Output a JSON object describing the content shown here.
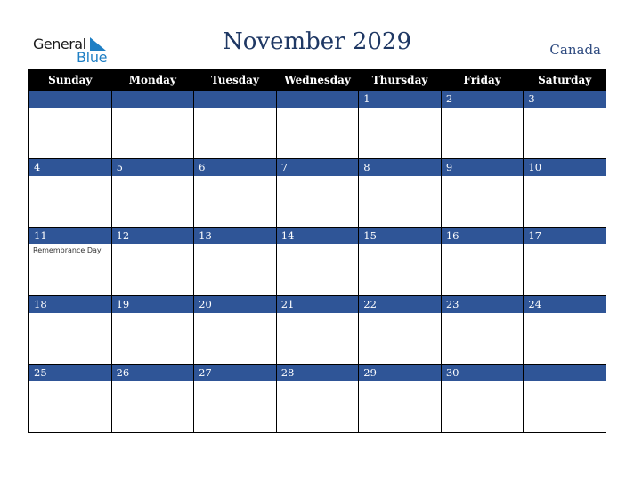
{
  "logo": {
    "word1": "General",
    "word2": "Blue"
  },
  "title": "November 2029",
  "country": "Canada",
  "colors": {
    "header_bg": "#000000",
    "band": "#2f5597",
    "title": "#1f3864",
    "logo_blue": "#1f7fc4"
  },
  "weekdays": [
    "Sunday",
    "Monday",
    "Tuesday",
    "Wednesday",
    "Thursday",
    "Friday",
    "Saturday"
  ],
  "weeks": [
    [
      {
        "day": ""
      },
      {
        "day": ""
      },
      {
        "day": ""
      },
      {
        "day": ""
      },
      {
        "day": "1"
      },
      {
        "day": "2"
      },
      {
        "day": "3"
      }
    ],
    [
      {
        "day": "4"
      },
      {
        "day": "5"
      },
      {
        "day": "6"
      },
      {
        "day": "7"
      },
      {
        "day": "8"
      },
      {
        "day": "9"
      },
      {
        "day": "10"
      }
    ],
    [
      {
        "day": "11",
        "holiday": "Remembrance Day"
      },
      {
        "day": "12"
      },
      {
        "day": "13"
      },
      {
        "day": "14"
      },
      {
        "day": "15"
      },
      {
        "day": "16"
      },
      {
        "day": "17"
      }
    ],
    [
      {
        "day": "18"
      },
      {
        "day": "19"
      },
      {
        "day": "20"
      },
      {
        "day": "21"
      },
      {
        "day": "22"
      },
      {
        "day": "23"
      },
      {
        "day": "24"
      }
    ],
    [
      {
        "day": "25"
      },
      {
        "day": "26"
      },
      {
        "day": "27"
      },
      {
        "day": "28"
      },
      {
        "day": "29"
      },
      {
        "day": "30"
      },
      {
        "day": ""
      }
    ]
  ]
}
